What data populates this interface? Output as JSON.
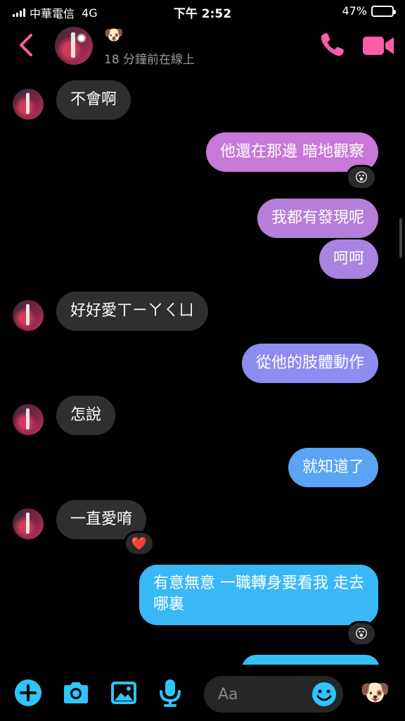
{
  "status_bar": {
    "carrier": "中華電信",
    "network": "4G",
    "time": "下午 2:52",
    "battery_percent": "47%",
    "battery_level": 0.47
  },
  "header": {
    "contact_emoji": "🐶",
    "online_status": "18 分鐘前在線上",
    "accent_color": "#ff5ca8"
  },
  "messages": [
    {
      "direction": "incoming",
      "text": "不會啊"
    },
    {
      "direction": "outgoing",
      "text": "他還在那邊 暗地觀察",
      "color": "#c878d8",
      "reaction": "😮"
    },
    {
      "direction": "outgoing",
      "text": "我都有發現呢",
      "color": "#b67ed8"
    },
    {
      "direction": "outgoing",
      "text": "呵呵",
      "color": "#a883e0"
    },
    {
      "direction": "incoming",
      "text": "好好愛ㄒㄧㄚㄑㄩ"
    },
    {
      "direction": "outgoing",
      "text": "從他的肢體動作",
      "color": "#8e8cf0"
    },
    {
      "direction": "incoming",
      "text": "怎說"
    },
    {
      "direction": "outgoing",
      "text": "就知道了",
      "color": "#5aa3f5"
    },
    {
      "direction": "incoming",
      "text": "一直愛唷",
      "reaction": "❤️"
    },
    {
      "direction": "outgoing",
      "text_line1": "有意無意 一職轉身要看我 走去",
      "text_line2": "哪裏",
      "color": "#3ab8f5",
      "reaction": "😮"
    }
  ],
  "composer": {
    "placeholder": "Aa"
  },
  "toolbar": {
    "icon_color": "#2ec5ff",
    "quick_emoji": "🐶"
  }
}
